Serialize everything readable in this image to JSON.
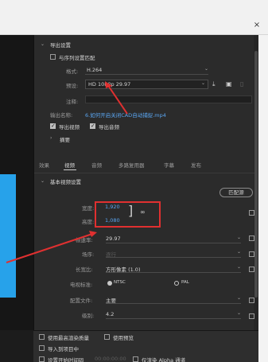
{
  "window": {
    "close_glyph": "×"
  },
  "export": {
    "section_title": "导出设置",
    "match_sequence_label": "与序列设置匹配",
    "format_label": "格式:",
    "format_value": "H.264",
    "preset_label": "预设:",
    "preset_value": "HD 1080p 29.97",
    "comments_label": "注释:",
    "output_name_label": "输出名称:",
    "output_name_value": "6.如何开启关闭CAD自动捕捉.mp4",
    "export_video_label": "导出视频",
    "export_audio_label": "导出音频",
    "summary_label": "摘要"
  },
  "tabs": [
    "效果",
    "视频",
    "音频",
    "多路复用器",
    "字幕",
    "发布"
  ],
  "video": {
    "section_title": "基本视频设置",
    "match_source_label": "匹配源",
    "width_label": "宽度:",
    "width_value": "1,920",
    "height_label": "高度:",
    "height_value": "1,080",
    "framerate_label": "帧速率:",
    "framerate_value": "29.97",
    "field_order_label": "场序:",
    "field_order_value": "逐行",
    "aspect_label": "长宽比:",
    "aspect_value": "方形像素 (1.0)",
    "tv_standard_label": "电视标准:",
    "tv_ntsc": "NTSC",
    "tv_pal": "PAL",
    "profile_label": "配置文件:",
    "profile_value": "主要",
    "level_label": "级别:",
    "level_value": "4.2"
  },
  "bottom": {
    "max_render_quality": "使用最高渲染质量",
    "use_previews": "使用预览",
    "import_into_project": "导入到项目中",
    "set_start_timecode": "设置开始时间码",
    "timecode_value": "00:00:00:00",
    "render_alpha_only": "仅渲染 Alpha 通道"
  },
  "colors": {
    "accent_blue": "#27a2ea",
    "annotation_red": "#e03030",
    "link_blue": "#5aa5f0"
  },
  "icons": [
    "close-icon",
    "import-preset-icon",
    "save-preset-icon",
    "delete-preset-icon",
    "link-icon",
    "chevron-down-icon",
    "expand-triangle-icon",
    "collapse-triangle-icon"
  ]
}
